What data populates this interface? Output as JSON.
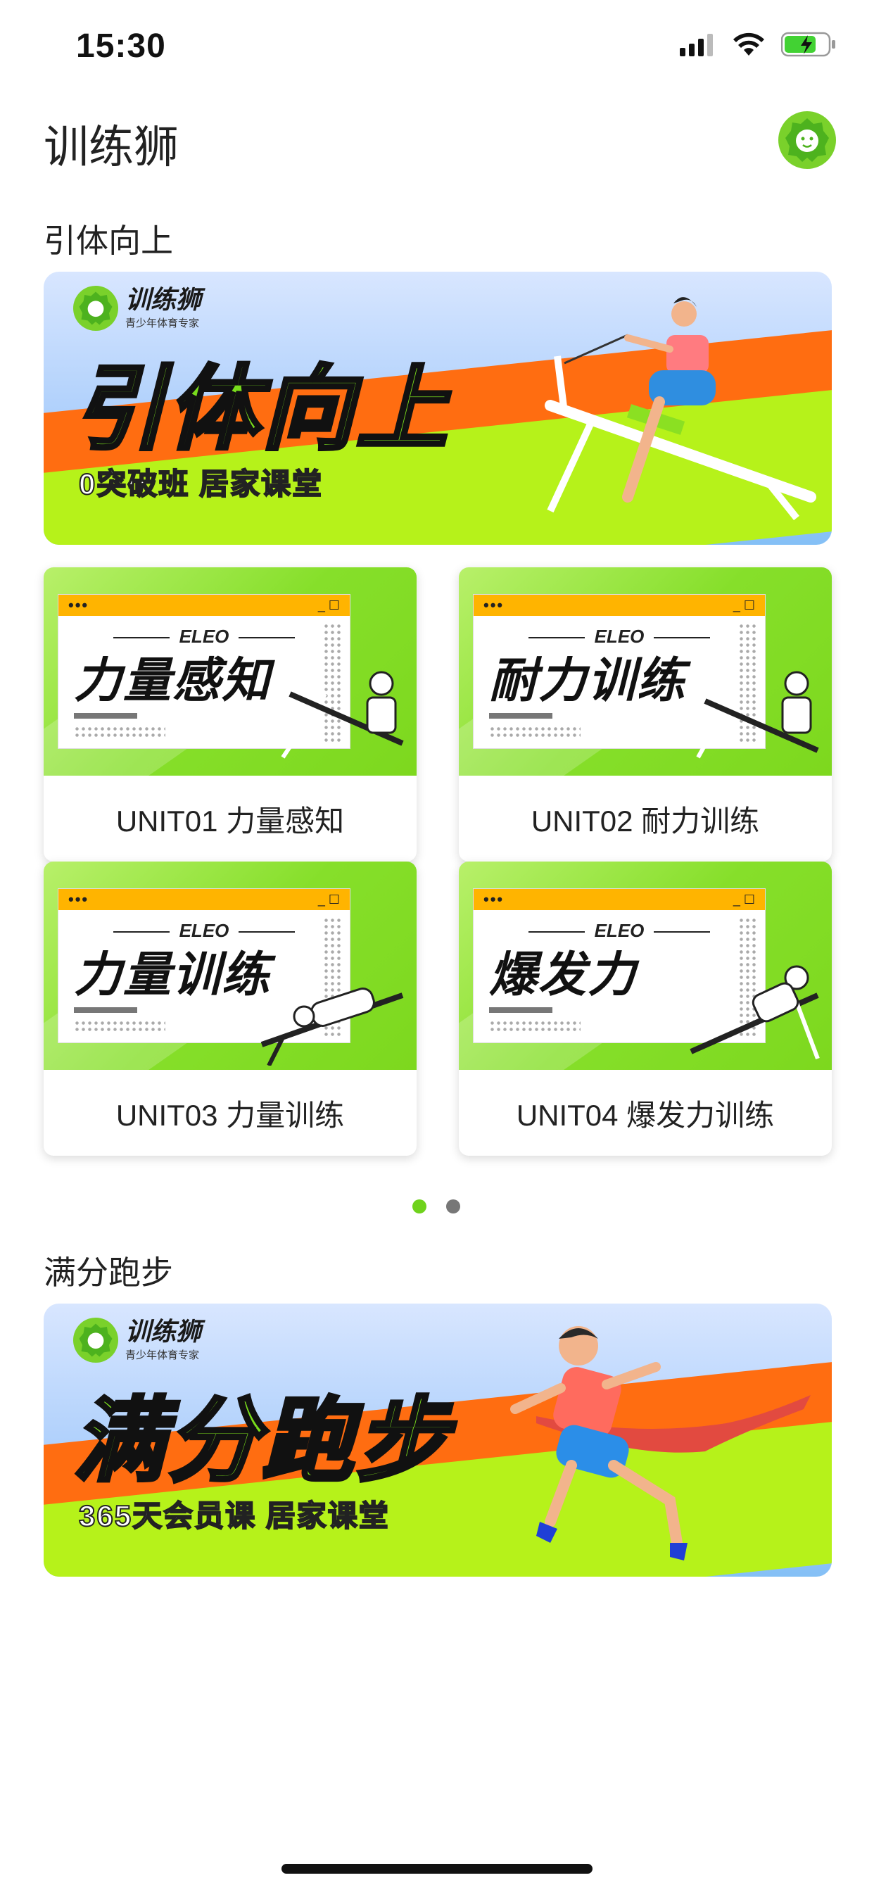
{
  "status_bar": {
    "time": "15:30"
  },
  "header": {
    "title": "训练狮"
  },
  "sections": [
    {
      "title": "引体向上",
      "banner": {
        "brand_name": "训练狮",
        "brand_sub": "青少年体育专家",
        "big_text": "引体向上",
        "sub_text": "0突破班 居家课堂"
      },
      "cards": [
        {
          "window_brand": "ELEO",
          "window_title": "力量感知",
          "caption": "UNIT01 力量感知"
        },
        {
          "window_brand": "ELEO",
          "window_title": "耐力训练",
          "caption": "UNIT02 耐力训练"
        },
        {
          "window_brand": "ELEO",
          "window_title": "力量训练",
          "caption": "UNIT03 力量训练"
        },
        {
          "window_brand": "ELEO",
          "window_title": "爆发力",
          "caption": "UNIT04 爆发力训练"
        }
      ],
      "pager": {
        "pages": 2,
        "active": 1
      }
    },
    {
      "title": "满分跑步",
      "banner": {
        "brand_name": "训练狮",
        "brand_sub": "青少年体育专家",
        "big_text": "满分跑步",
        "sub_text": "365天会员课 居家课堂"
      }
    }
  ],
  "colors": {
    "accent_green": "#7ad12b",
    "pager_active": "#6fd21c",
    "pager_inactive": "#777777",
    "banner_orange": "#ff6d11",
    "banner_lime": "#b6f21a",
    "window_bar": "#ffb400"
  },
  "icons": {
    "signal": "cellular-signal-icon",
    "wifi": "wifi-icon",
    "battery": "battery-charging-icon",
    "avatar": "lion-logo-icon"
  }
}
